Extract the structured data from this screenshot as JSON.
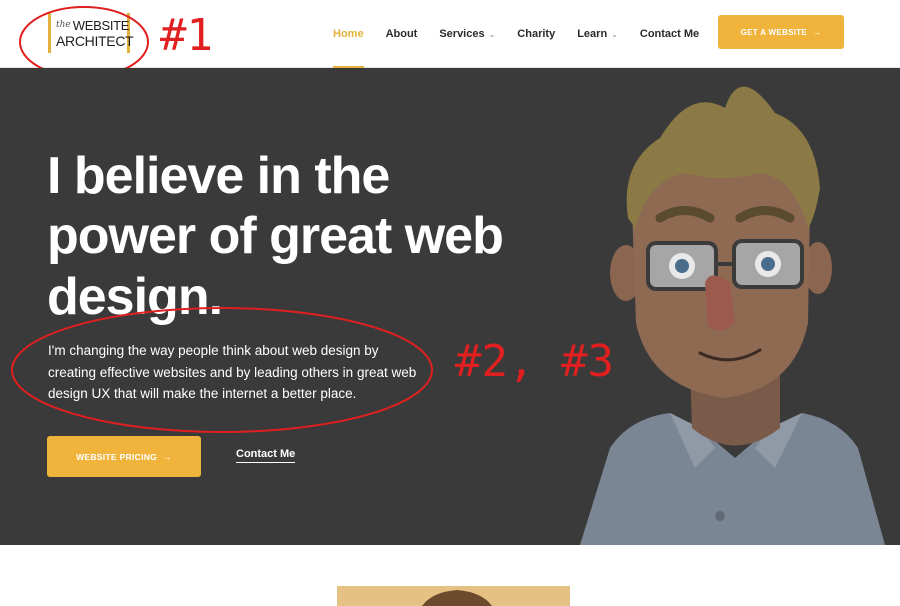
{
  "logo": {
    "the": "the",
    "line1": "WEBSITE",
    "line2": "ARCHITECT"
  },
  "nav": {
    "items": [
      {
        "label": "Home",
        "active": true,
        "has_dropdown": false
      },
      {
        "label": "About",
        "active": false,
        "has_dropdown": false
      },
      {
        "label": "Services",
        "active": false,
        "has_dropdown": true
      },
      {
        "label": "Charity",
        "active": false,
        "has_dropdown": false
      },
      {
        "label": "Learn",
        "active": false,
        "has_dropdown": true
      },
      {
        "label": "Contact Me",
        "active": false,
        "has_dropdown": false
      }
    ],
    "cta_label": "GET A WEBSITE",
    "cta_arrow": "→"
  },
  "hero": {
    "headline_1": "I believe in the",
    "headline_2": "power of great web",
    "headline_3": "design.",
    "subtext": "I'm changing the way people think about web design by creating effective websites and by leading others in great web design UX that will make the internet a better place.",
    "primary_button": "WEBSITE PRICING",
    "primary_arrow": "→",
    "secondary_link": "Contact Me"
  },
  "annotations": {
    "a1": "#1",
    "a2": "#2, #3"
  },
  "colors": {
    "accent": "#f0b43c",
    "hero_bg": "#3a3a3a",
    "annotation": "#e02020"
  },
  "icons": {
    "chevron": "chevron-down-icon",
    "arrow": "arrow-right-icon"
  }
}
